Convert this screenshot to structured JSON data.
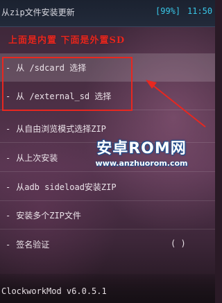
{
  "header": {
    "title": "从zip文件安装更新",
    "battery": "[99%]",
    "clock": "11:50"
  },
  "annotation": "上面是内置 下面是外置SD",
  "menu": {
    "bullet": "-",
    "items": [
      {
        "label": "从 /sdcard 选择"
      },
      {
        "label": "从 /external_sd 选择"
      },
      {
        "label": "从自由浏览模式选择ZIP"
      },
      {
        "label": "从上次安装"
      },
      {
        "label": "从adb sideload安装ZIP"
      },
      {
        "label": "安装多个ZIP文件"
      },
      {
        "label": "签名验证",
        "state": "( )"
      }
    ]
  },
  "watermark": {
    "title": "安卓ROM网",
    "url": "www.anzhuorom.com"
  },
  "footer": {
    "text": "ClockworkMod v6.0.5.1"
  },
  "colors": {
    "accent_status": "#39c7e8",
    "annotation_red": "#e8271f"
  }
}
